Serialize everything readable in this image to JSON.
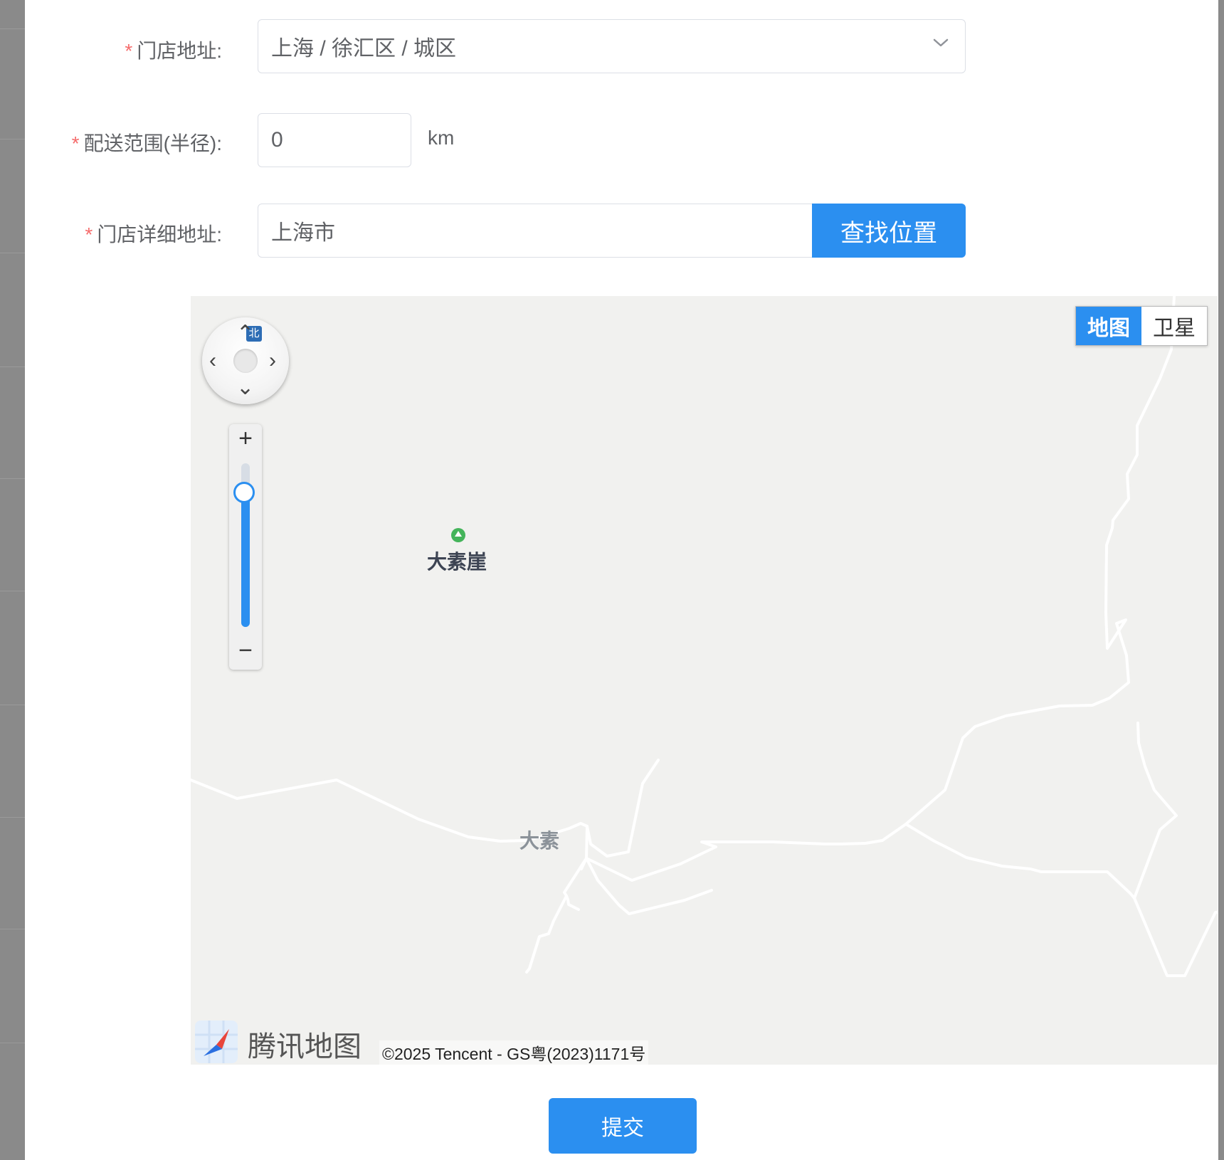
{
  "form": {
    "store_address": {
      "label": "门店地址:",
      "value": "上海 / 徐汇区 / 城区"
    },
    "delivery_range": {
      "label": "配送范围(半径):",
      "value": "0",
      "unit": "km"
    },
    "store_detail_address": {
      "label": "门店详细地址:",
      "value": "上海市",
      "search_button": "查找位置"
    },
    "required_mark": "*"
  },
  "map": {
    "north_label": "北",
    "zoom_in": "+",
    "zoom_out": "−",
    "zoom_level_fraction": 0.82,
    "poi_label": "大素崖",
    "place_label": "大素",
    "map_type": {
      "map": "地图",
      "satellite": "卫星",
      "active": "map"
    },
    "logo_text": "腾讯地图",
    "copyright": "©2025 Tencent - GS粤(2023)1171号"
  },
  "submit_label": "提交",
  "colors": {
    "primary": "#2b8ff0",
    "required": "#f56c6c",
    "map_bg": "#f1f1ef",
    "poi": "#44b45a"
  }
}
